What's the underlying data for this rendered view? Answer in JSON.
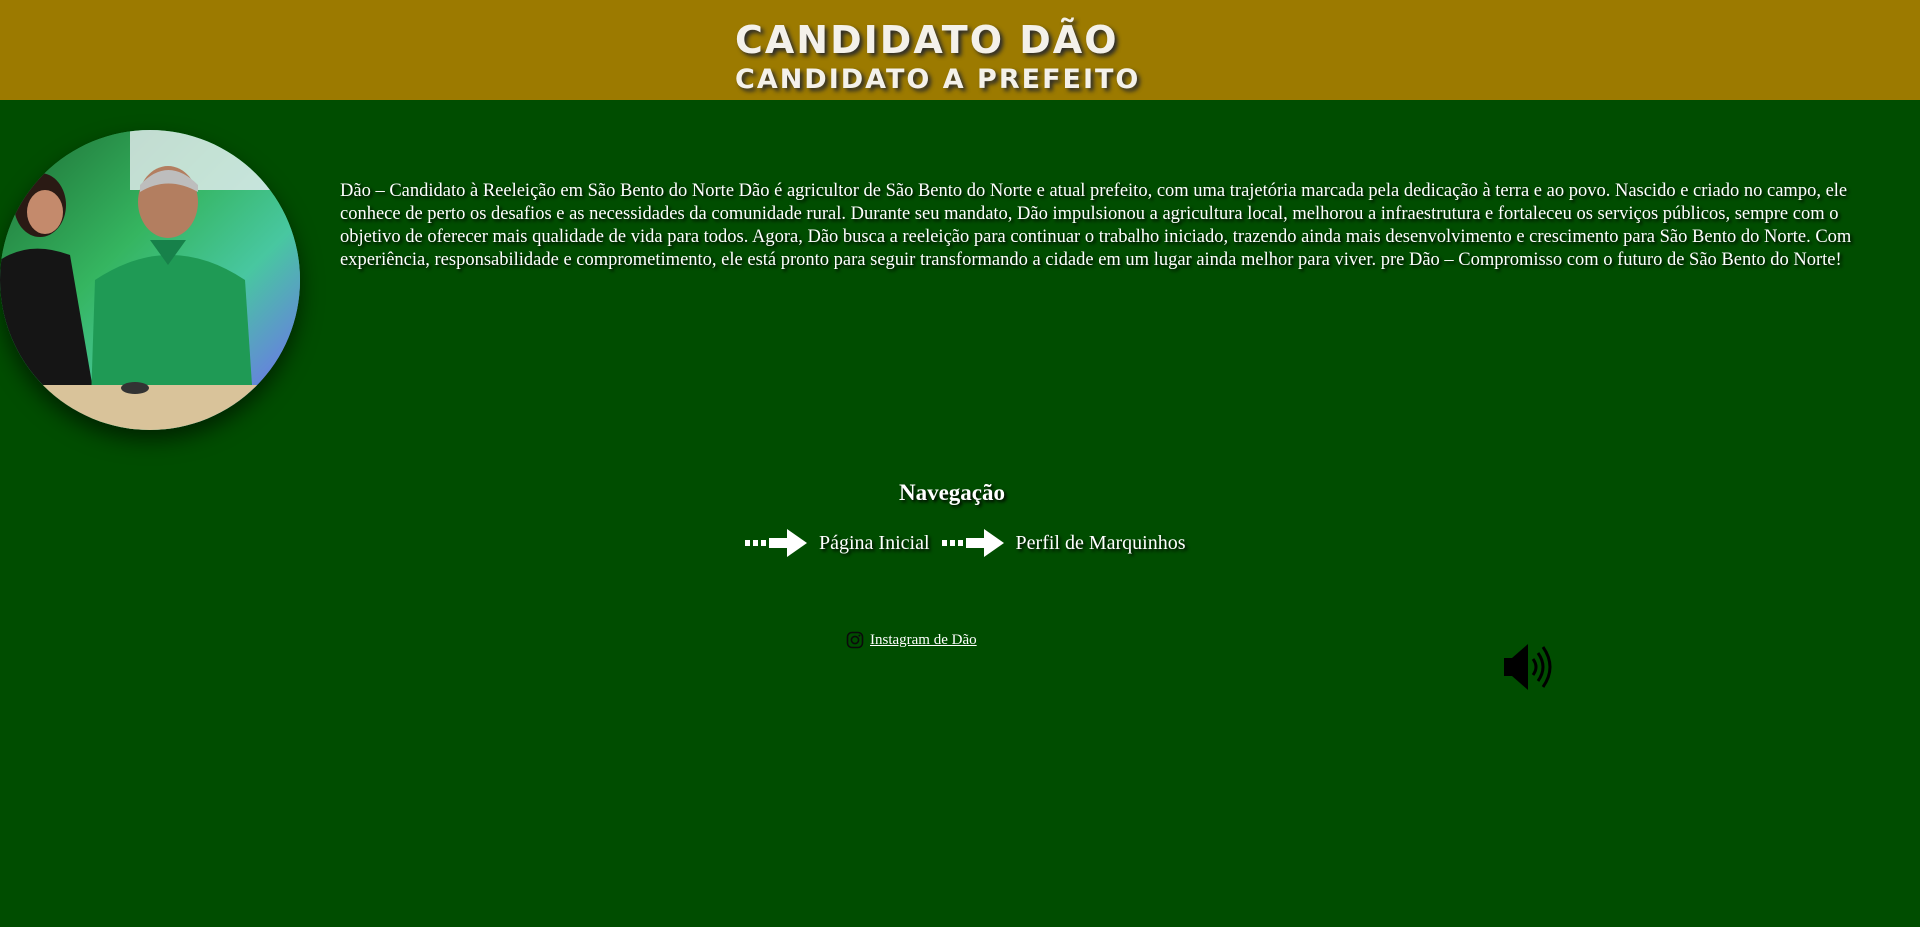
{
  "header": {
    "title": "CANDIDATO DÃO",
    "subtitle": "CANDIDATO A PREFEITO"
  },
  "bio": {
    "text": "Dão – Candidato à Reeleição em São Bento do Norte Dão é agricultor de São Bento do Norte e atual prefeito, com uma trajetória marcada pela dedicação à terra e ao povo. Nascido e criado no campo, ele conhece de perto os desafios e as necessidades da comunidade rural. Durante seu mandato, Dão impulsionou a agricultura local, melhorou a infraestrutura e fortaleceu os serviços públicos, sempre com o objetivo de oferecer mais qualidade de vida para todos. Agora, Dão busca a reeleição para continuar o trabalho iniciado, trazendo ainda mais desenvolvimento e crescimento para São Bento do Norte. Com experiência, responsabilidade e comprometimento, ele está pronto para seguir transformando a cidade em um lugar ainda melhor para viver. pre Dão – Compromisso com o futuro de São Bento do Norte!"
  },
  "nav": {
    "title": "Navegação",
    "items": [
      {
        "label": "Página Inicial",
        "icon": "arrow-right-icon"
      },
      {
        "label": "Perfil de Marquinhos",
        "icon": "arrow-right-icon"
      }
    ]
  },
  "footer": {
    "instagram_label": "Instagram de Dão",
    "instagram_icon": "instagram-icon",
    "audio_icon": "speaker-icon"
  },
  "colors": {
    "header_bg": "#9c7a00",
    "page_bg": "#004d00",
    "text": "#ffffff"
  }
}
